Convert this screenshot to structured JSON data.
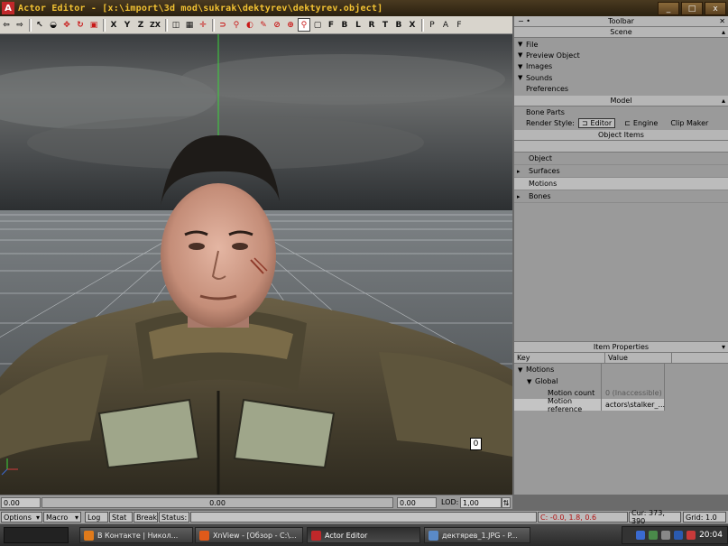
{
  "window": {
    "title": "Actor Editor - [x:\\import\\3d mod\\sukrak\\dektyrev\\dektyrev.object]",
    "app_icon": "A",
    "buttons": [
      "_",
      "□",
      "x"
    ]
  },
  "toolbar": {
    "axis_x": "X",
    "axis_y": "Y",
    "axis_z": "Z",
    "axis_zx": "ZX",
    "view_buttons": [
      "F",
      "B",
      "L",
      "R",
      "T",
      "B",
      "X"
    ],
    "p": "P",
    "a": "A",
    "f": "F"
  },
  "right_panel": {
    "toolbar_header": "Toolbar",
    "toolbar_left": "− •",
    "toolbar_right": "✕",
    "scene_header": "Scene",
    "scene_items": [
      {
        "label": "File",
        "arrow": "▼"
      },
      {
        "label": "Preview Object",
        "arrow": "▼"
      },
      {
        "label": "Images",
        "arrow": "▼"
      },
      {
        "label": "Sounds",
        "arrow": "▼"
      },
      {
        "label": "Preferences",
        "arrow": ""
      }
    ],
    "model_header": "Model",
    "bone_parts": "Bone Parts",
    "render_style_label": "Render Style:",
    "render_editor": "Editor",
    "render_engine": "Engine",
    "clip_maker": "Clip Maker",
    "object_items_header": "Object Items",
    "object_items": [
      {
        "label": "Object",
        "arrow": "",
        "selected": false
      },
      {
        "label": "Surfaces",
        "arrow": "▸",
        "selected": false
      },
      {
        "label": "Motions",
        "arrow": "",
        "selected": true
      },
      {
        "label": "Bones",
        "arrow": "▸",
        "selected": false
      }
    ],
    "item_properties_header": "Item Properties",
    "col_key": "Key",
    "col_value": "Value",
    "properties": [
      {
        "key": "Motions",
        "value": "",
        "arrow": "▼",
        "indent": 0
      },
      {
        "key": "Global",
        "value": "",
        "arrow": "▼",
        "indent": 1
      },
      {
        "key": "Motion count",
        "value": "0 (Inaccessible)",
        "arrow": "",
        "indent": 2
      },
      {
        "key": "Motion reference",
        "value": "actors\\stalker_...",
        "arrow": "",
        "indent": 2
      }
    ],
    "ellipsis": "..."
  },
  "viewport": {
    "badge": "0"
  },
  "lod_bar": {
    "left_value": "0.00",
    "mid_value": "0.00",
    "right_value": "0.00",
    "lod_label": "LOD:",
    "lod_value": "1,00"
  },
  "status_bar": {
    "options": "Options",
    "macro": "Macro",
    "log": "Log",
    "stat": "Stat",
    "break": "Break",
    "status": "Status:",
    "coords": "C: -0.0, 1.8, 0.6",
    "cursor": "Cur: 373, 390",
    "grid": "Grid: 1.0"
  },
  "taskbar": {
    "tasks": [
      {
        "label": "В Контакте | Никол...",
        "icon_color": "#e07a1a"
      },
      {
        "label": "XnView - [Обзор - C:\\...",
        "icon_color": "#e05a1a"
      },
      {
        "label": "Actor Editor",
        "icon_color": "#c0282a"
      },
      {
        "label": "дектярев_1.JPG - P...",
        "icon_color": "#5a8ac8"
      }
    ],
    "clock": "20:04"
  }
}
